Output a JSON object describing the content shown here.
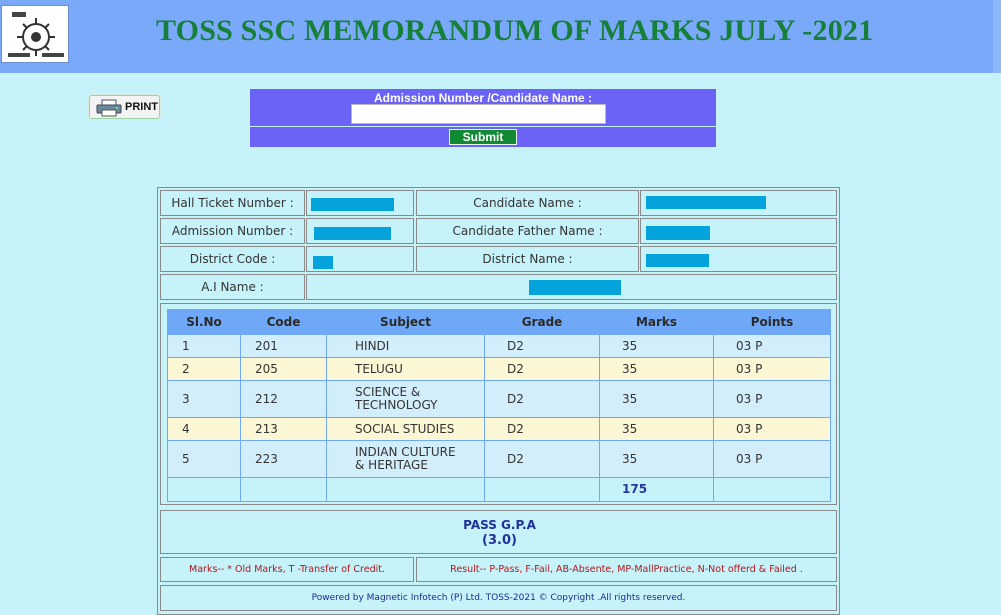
{
  "header": {
    "title": "TOSS SSC MEMORANDUM OF MARKS JULY -2021",
    "logo_icon": "toss-emblem-logo"
  },
  "print_button": {
    "label": "PRINT",
    "icon": "printer-icon"
  },
  "search": {
    "label": "Admission Number /Candidate Name :",
    "value": "",
    "submit_label": "Submit"
  },
  "details": {
    "hall_ticket_label": "Hall Ticket Number :",
    "admission_label": "Admission Number :",
    "district_code_label": "District Code :",
    "ai_name_label": "A.I Name :",
    "candidate_name_label": "Candidate Name :",
    "father_name_label": "Candidate Father Name :",
    "district_name_label": "District Name :"
  },
  "marks": {
    "headers": [
      "Sl.No",
      "Code",
      "Subject",
      "Grade",
      "Marks",
      "Points"
    ],
    "rows": [
      {
        "slno": "1",
        "code": "201",
        "subject": "HINDI",
        "grade": "D2",
        "marks": "35",
        "points": "03 P"
      },
      {
        "slno": "2",
        "code": "205",
        "subject": "TELUGU",
        "grade": "D2",
        "marks": "35",
        "points": "03 P"
      },
      {
        "slno": "3",
        "code": "212",
        "subject": "SCIENCE &",
        "subject2": "TECHNOLOGY",
        "grade": "D2",
        "marks": "35",
        "points": "03 P"
      },
      {
        "slno": "4",
        "code": "213",
        "subject": "SOCIAL STUDIES",
        "grade": "D2",
        "marks": "35",
        "points": "03 P"
      },
      {
        "slno": "5",
        "code": "223",
        "subject": "INDIAN CULTURE",
        "subject2": "& HERITAGE",
        "grade": "D2",
        "marks": "35",
        "points": "03 P"
      }
    ],
    "total": "175"
  },
  "result": {
    "line1": "PASS G.P.A",
    "line2": "(3.0)"
  },
  "legend": {
    "marks_note": "Marks-- * Old Marks, T -Transfer of Credit.",
    "result_note": "Result-- P-Pass, F-Fail, AB-Absente,  MP-MallPractice, N-Not offerd & Failed ."
  },
  "footer": {
    "text": "Powered by Magnetic Infotech (P) Ltd. TOSS-2021  © Copyright .All rights reserved."
  },
  "colors": {
    "page_bg": "#c6f2fa",
    "header_bg": "#7ba9f9",
    "title_green": "#16803a",
    "search_bg": "#6b63f5",
    "table_header": "#6fa8f7",
    "row_blue": "#d3eefb",
    "row_yellow": "#fbf7d4",
    "redaction": "#05a3dc",
    "legend_red": "#b3161b"
  }
}
